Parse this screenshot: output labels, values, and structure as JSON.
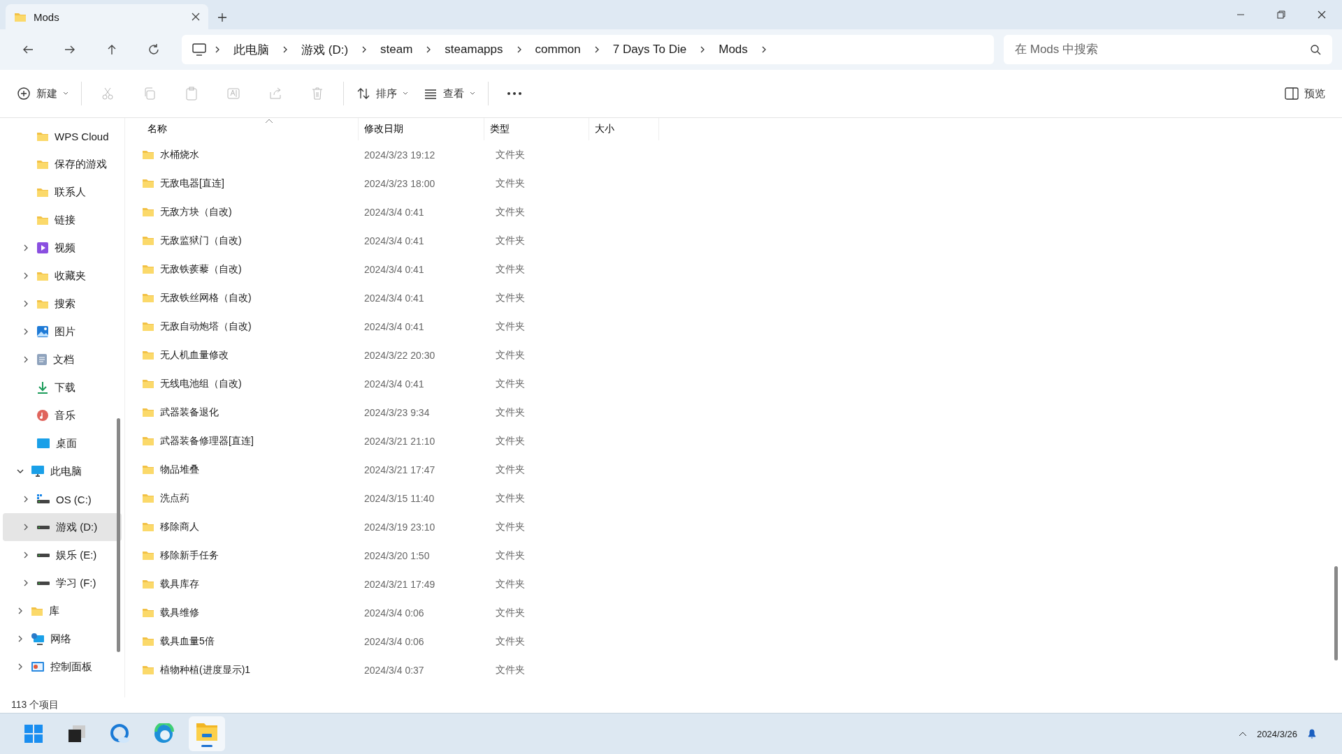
{
  "window": {
    "tab_title": "Mods"
  },
  "address": {
    "crumbs": [
      "此电脑",
      "游戏 (D:)",
      "steam",
      "steamapps",
      "common",
      "7 Days To Die",
      "Mods"
    ],
    "search_placeholder": "在 Mods 中搜索"
  },
  "toolbar": {
    "actions": [
      {
        "kind": "new",
        "label": "新建",
        "disabled": false
      },
      {
        "kind": "cut",
        "disabled": true
      },
      {
        "kind": "copy",
        "disabled": true
      },
      {
        "kind": "paste",
        "disabled": true
      },
      {
        "kind": "rename",
        "disabled": true
      },
      {
        "kind": "share",
        "disabled": true
      },
      {
        "kind": "delete",
        "disabled": true
      },
      {
        "kind": "sort",
        "label": "排序",
        "disabled": false
      },
      {
        "kind": "view",
        "label": "查看",
        "disabled": false
      },
      {
        "kind": "more",
        "disabled": false
      }
    ],
    "preview": "预览"
  },
  "sidebar": {
    "items": [
      {
        "label": "WPS Cloud",
        "kind": "folder",
        "expandable": false,
        "selected": false
      },
      {
        "label": "保存的游戏",
        "kind": "folder",
        "expandable": false,
        "selected": false
      },
      {
        "label": "联系人",
        "kind": "folder",
        "expandable": false,
        "selected": false
      },
      {
        "label": "链接",
        "kind": "folder",
        "expandable": false,
        "selected": false
      },
      {
        "label": "视频",
        "kind": "video",
        "expandable": true,
        "expanded": false,
        "selected": false
      },
      {
        "label": "收藏夹",
        "kind": "folder",
        "expandable": true,
        "expanded": false,
        "selected": false
      },
      {
        "label": "搜索",
        "kind": "folder",
        "expandable": true,
        "expanded": false,
        "selected": false
      },
      {
        "label": "图片",
        "kind": "picture",
        "expandable": true,
        "expanded": false,
        "selected": false
      },
      {
        "label": "文档",
        "kind": "document",
        "expandable": true,
        "expanded": false,
        "selected": false
      },
      {
        "label": "下载",
        "kind": "download",
        "expandable": false,
        "selected": false
      },
      {
        "label": "音乐",
        "kind": "music",
        "expandable": false,
        "selected": false
      },
      {
        "label": "桌面",
        "kind": "desktop",
        "expandable": false,
        "selected": false
      }
    ],
    "roots": [
      {
        "label": "此电脑",
        "kind": "pc",
        "expandable": true,
        "expanded": true,
        "selected": false,
        "children": [
          {
            "label": "OS (C:)",
            "kind": "drive-os",
            "expandable": true,
            "expanded": false,
            "selected": false
          },
          {
            "label": "游戏 (D:)",
            "kind": "drive",
            "expandable": true,
            "expanded": false,
            "selected": true
          },
          {
            "label": "娱乐 (E:)",
            "kind": "drive",
            "expandable": true,
            "expanded": false,
            "selected": false
          },
          {
            "label": "学习 (F:)",
            "kind": "drive",
            "expandable": true,
            "expanded": false,
            "selected": false
          }
        ]
      },
      {
        "label": "库",
        "kind": "folder",
        "expandable": true,
        "expanded": false,
        "selected": false
      },
      {
        "label": "网络",
        "kind": "network",
        "expandable": true,
        "expanded": false,
        "selected": false
      },
      {
        "label": "控制面板",
        "kind": "control",
        "expandable": true,
        "expanded": false,
        "selected": false
      }
    ]
  },
  "table": {
    "columns": [
      "名称",
      "修改日期",
      "类型",
      "大小"
    ],
    "rows": [
      {
        "name": "水桶烧水",
        "modified": "2024/3/23 19:12",
        "type": "文件夹"
      },
      {
        "name": "无敌电器[直连]",
        "modified": "2024/3/23 18:00",
        "type": "文件夹"
      },
      {
        "name": "无敌方块（自改)",
        "modified": "2024/3/4 0:41",
        "type": "文件夹"
      },
      {
        "name": "无敌监狱门（自改)",
        "modified": "2024/3/4 0:41",
        "type": "文件夹"
      },
      {
        "name": "无敌铁蒺藜（自改)",
        "modified": "2024/3/4 0:41",
        "type": "文件夹"
      },
      {
        "name": "无敌铁丝网格（自改)",
        "modified": "2024/3/4 0:41",
        "type": "文件夹"
      },
      {
        "name": "无敌自动炮塔（自改)",
        "modified": "2024/3/4 0:41",
        "type": "文件夹"
      },
      {
        "name": "无人机血量修改",
        "modified": "2024/3/22 20:30",
        "type": "文件夹"
      },
      {
        "name": "无线电池组（自改)",
        "modified": "2024/3/4 0:41",
        "type": "文件夹"
      },
      {
        "name": "武器装备退化",
        "modified": "2024/3/23 9:34",
        "type": "文件夹"
      },
      {
        "name": "武器装备修理器[直连]",
        "modified": "2024/3/21 21:10",
        "type": "文件夹"
      },
      {
        "name": "物品堆叠",
        "modified": "2024/3/21 17:47",
        "type": "文件夹"
      },
      {
        "name": "洗点药",
        "modified": "2024/3/15 11:40",
        "type": "文件夹"
      },
      {
        "name": "移除商人",
        "modified": "2024/3/19 23:10",
        "type": "文件夹"
      },
      {
        "name": "移除新手任务",
        "modified": "2024/3/20 1:50",
        "type": "文件夹"
      },
      {
        "name": "载具库存",
        "modified": "2024/3/21 17:49",
        "type": "文件夹"
      },
      {
        "name": "载具维修",
        "modified": "2024/3/4 0:06",
        "type": "文件夹"
      },
      {
        "name": "载具血量5倍",
        "modified": "2024/3/4 0:06",
        "type": "文件夹"
      },
      {
        "name": "植物种植(进度显示)1",
        "modified": "2024/3/4 0:37",
        "type": "文件夹"
      }
    ]
  },
  "status_bar": {
    "count": "113 个项目"
  },
  "taskbar": {
    "apps": [
      {
        "kind": "start",
        "active": false
      },
      {
        "kind": "taskview",
        "active": false
      },
      {
        "kind": "copilot",
        "active": false
      },
      {
        "kind": "edge",
        "active": false
      },
      {
        "kind": "explorer",
        "active": true
      }
    ],
    "date": "2024/3/26"
  }
}
